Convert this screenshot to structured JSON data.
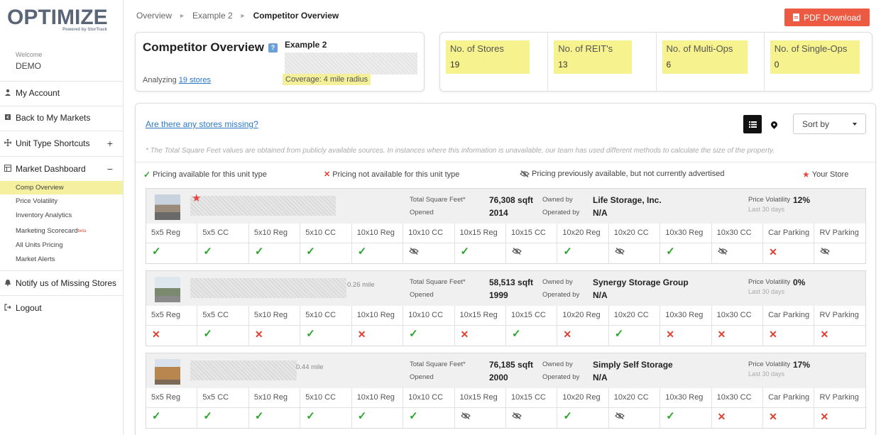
{
  "brand": {
    "logo": "OPTIMIZE",
    "powered_by": "Powered by StorTrack"
  },
  "user": {
    "welcome": "Welcome",
    "name": "DEMO"
  },
  "sidebar": {
    "items": [
      {
        "label": "My Account",
        "icon": "user-icon"
      },
      {
        "label": "Back to My Markets",
        "icon": "back-icon"
      },
      {
        "label": "Unit Type Shortcuts",
        "icon": "move-icon",
        "right": "+"
      },
      {
        "label": "Market Dashboard",
        "icon": "dashboard-icon",
        "right": "−"
      },
      {
        "label": "Notify us of Missing Stores",
        "icon": "bell-icon"
      },
      {
        "label": "Logout",
        "icon": "logout-icon"
      }
    ],
    "sub_items": [
      "Comp Overview",
      "Price Volatility",
      "Inventory Analytics",
      "Marketing Scorecard",
      "All Units Pricing",
      "Market Alerts"
    ],
    "beta": "beta"
  },
  "breadcrumb": [
    "Overview",
    "Example 2",
    "Competitor Overview"
  ],
  "pdf_button": "PDF Download",
  "overview": {
    "title": "Competitor Overview",
    "analyzing_prefix": "Analyzing",
    "analyzing_link": "19 stores",
    "market_name": "Example 2",
    "coverage": "Coverage: 4 mile radius"
  },
  "stats": [
    {
      "label": "No. of Stores",
      "value": "19"
    },
    {
      "label": "No. of REIT's",
      "value": "13"
    },
    {
      "label": "No. of Multi-Ops",
      "value": "6"
    },
    {
      "label": "No. of Single-Ops",
      "value": "0"
    }
  ],
  "main": {
    "missing_link": "Are there any stores missing?",
    "sort_label": "Sort by",
    "disclaimer": "* The Total Square Feet values are obtained from publicly available sources. In instances where this information is unavailable, our team has used different methods to calculate the size of the property."
  },
  "legend": {
    "available": "Pricing available for this unit type",
    "not_available": "Pricing not available for this unit type",
    "previously": "Pricing previously available, but not currently advertised",
    "your_store": "Your Store"
  },
  "labels": {
    "total_sqft": "Total Square Feet*",
    "opened": "Opened",
    "owned_by": "Owned by",
    "operated_by": "Operated by",
    "price_volatility": "Price Volatility",
    "last_30_days": "Last 30 days"
  },
  "unit_types": [
    "5x5 Reg",
    "5x5 CC",
    "5x10 Reg",
    "5x10 CC",
    "10x10 Reg",
    "10x10 CC",
    "10x15 Reg",
    "10x15 CC",
    "10x20 Reg",
    "10x20 CC",
    "10x30 Reg",
    "10x30 CC",
    "Car Parking",
    "RV Parking"
  ],
  "stores": [
    {
      "is_your_store": true,
      "distance": "",
      "total_sqft": "76,308 sqft",
      "opened": "2014",
      "owned_by": "Life Storage, Inc.",
      "operated_by": "N/A",
      "price_volatility": "12%",
      "availability": [
        "check",
        "check",
        "check",
        "check",
        "check",
        "hidden",
        "check",
        "hidden",
        "check",
        "hidden",
        "check",
        "hidden",
        "cross",
        "hidden"
      ]
    },
    {
      "is_your_store": false,
      "distance": "0.26 mile",
      "total_sqft": "58,513 sqft",
      "opened": "1999",
      "owned_by": "Synergy Storage Group",
      "operated_by": "N/A",
      "price_volatility": "0%",
      "availability": [
        "cross",
        "check",
        "cross",
        "check",
        "cross",
        "check",
        "cross",
        "check",
        "cross",
        "check",
        "cross",
        "cross",
        "cross",
        "cross"
      ]
    },
    {
      "is_your_store": false,
      "distance": "0.44 mile",
      "total_sqft": "76,185 sqft",
      "opened": "2000",
      "owned_by": "Simply Self Storage",
      "operated_by": "N/A",
      "price_volatility": "17%",
      "availability": [
        "check",
        "check",
        "check",
        "check",
        "check",
        "check",
        "hidden",
        "hidden",
        "check",
        "hidden",
        "check",
        "cross",
        "cross",
        "cross"
      ]
    }
  ],
  "colors": {
    "accent_red": "#ec5a42",
    "highlight": "#f6f38e",
    "link": "#2a79c9",
    "check": "#2aa52a",
    "cross": "#e03e2f"
  }
}
